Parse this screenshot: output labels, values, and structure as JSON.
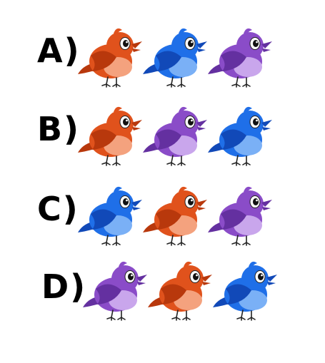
{
  "colors": {
    "orange": {
      "body": "#e0521c",
      "belly": "#f4a27e",
      "dark": "#b8380c"
    },
    "blue": {
      "body": "#1f6fe8",
      "belly": "#7ab0f6",
      "dark": "#1149b8"
    },
    "purple": {
      "body": "#8a4cc8",
      "belly": "#c9a6ec",
      "dark": "#6430a0"
    }
  },
  "options": [
    {
      "label": "A)",
      "birds": [
        "orange",
        "blue",
        "purple"
      ]
    },
    {
      "label": "B)",
      "birds": [
        "orange",
        "purple",
        "blue"
      ]
    },
    {
      "label": "C)",
      "birds": [
        "blue",
        "orange",
        "purple"
      ]
    },
    {
      "label": "D)",
      "birds": [
        "purple",
        "orange",
        "blue"
      ]
    }
  ]
}
